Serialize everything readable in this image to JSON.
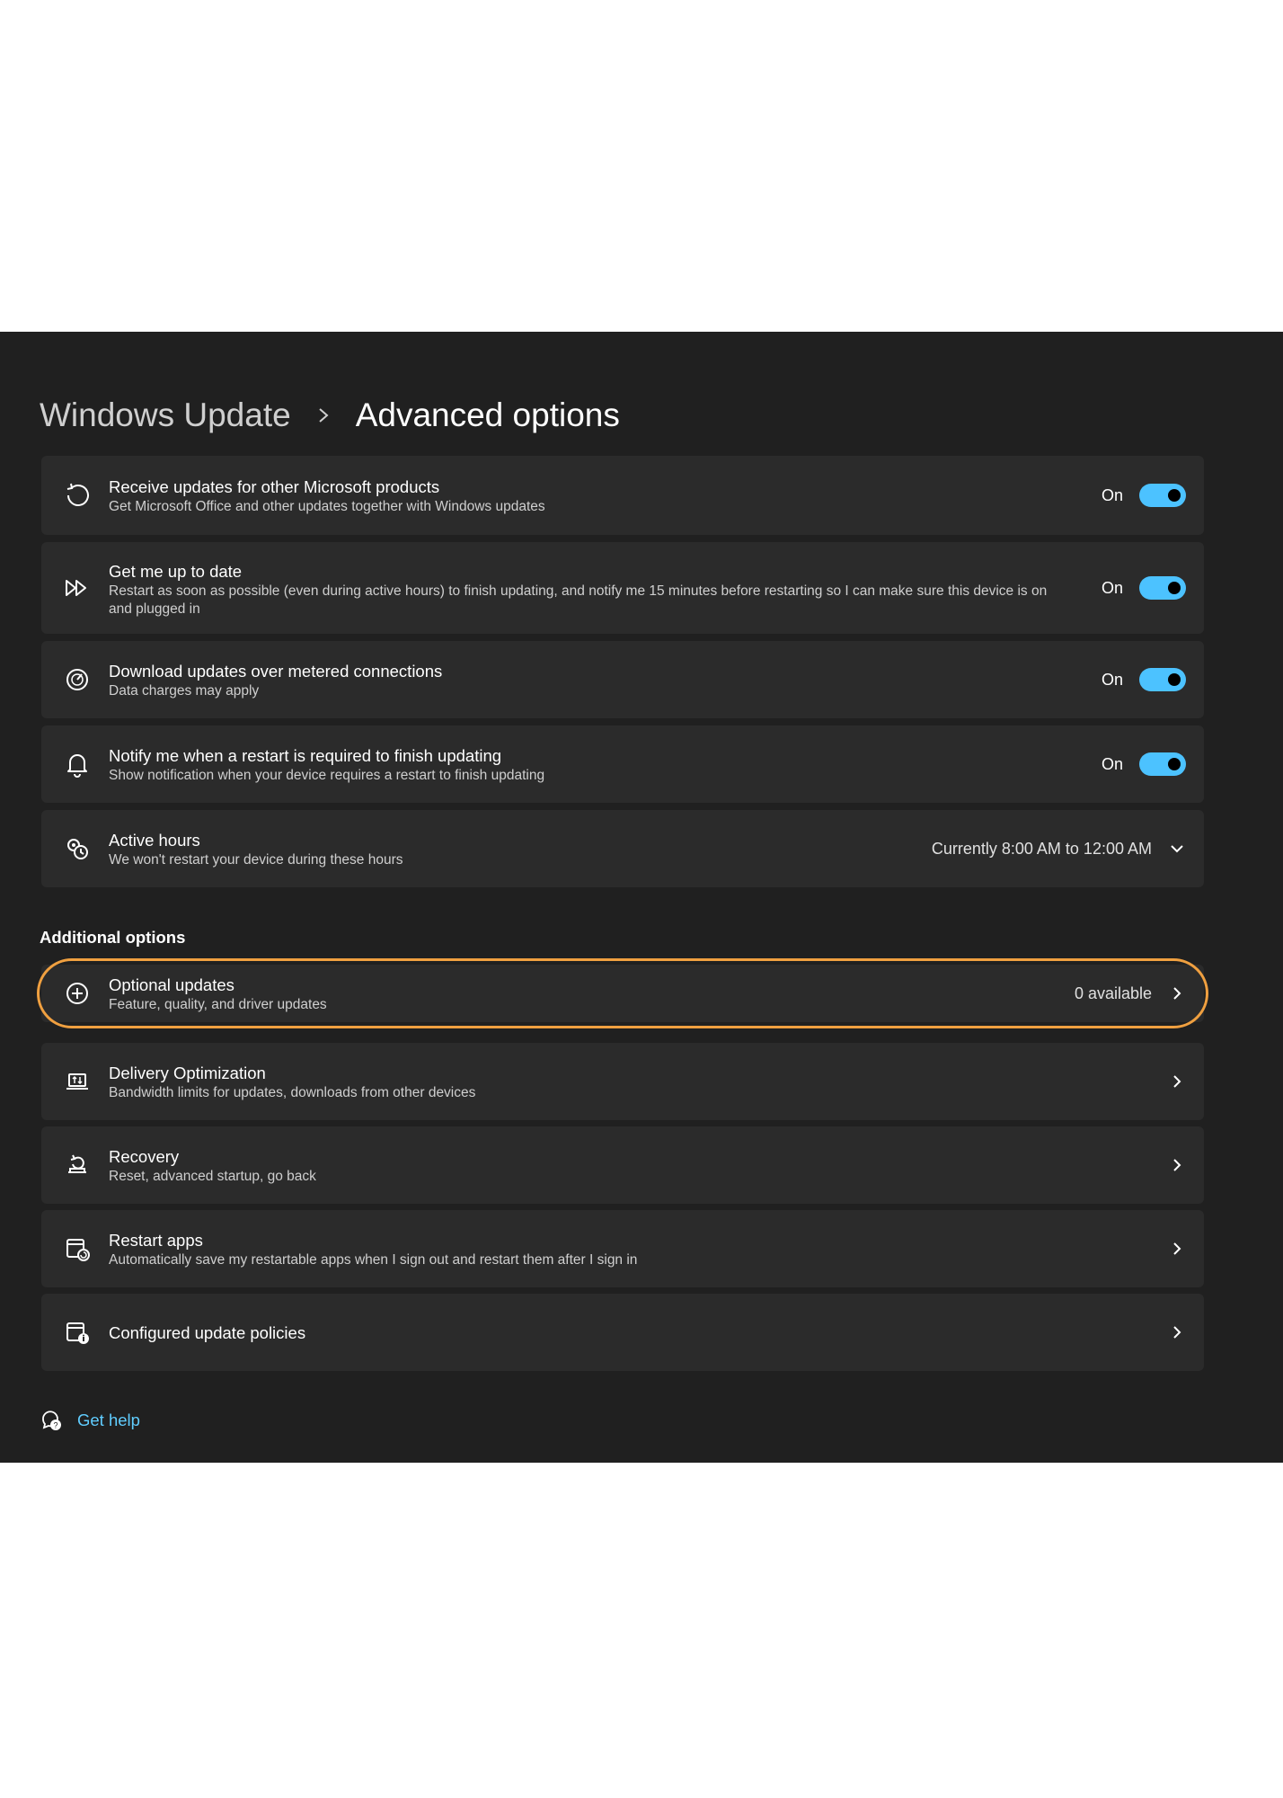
{
  "breadcrumb": {
    "parent": "Windows Update",
    "current": "Advanced options"
  },
  "settings": [
    {
      "title": "Receive updates for other Microsoft products",
      "desc": "Get Microsoft Office and other updates together with Windows updates",
      "state": "On",
      "icon": "refresh-icon"
    },
    {
      "title": "Get me up to date",
      "desc": "Restart as soon as possible (even during active hours) to finish updating, and notify me 15 minutes before restarting so I can make sure this device is on and plugged in",
      "state": "On",
      "icon": "fast-forward-icon"
    },
    {
      "title": "Download updates over metered connections",
      "desc": "Data charges may apply",
      "state": "On",
      "icon": "gauge-icon"
    },
    {
      "title": "Notify me when a restart is required to finish updating",
      "desc": "Show notification when your device requires a restart to finish updating",
      "state": "On",
      "icon": "bell-icon"
    },
    {
      "title": "Active hours",
      "desc": "We won't restart your device during these hours",
      "value": "Currently 8:00 AM to 12:00 AM",
      "icon": "clock-gear-icon"
    }
  ],
  "additional": {
    "heading": "Additional options",
    "items": [
      {
        "title": "Optional updates",
        "desc": "Feature, quality, and driver updates",
        "value": "0 available",
        "icon": "circle-plus-icon"
      },
      {
        "title": "Delivery Optimization",
        "desc": "Bandwidth limits for updates, downloads from other devices",
        "icon": "delivery-optimization-icon"
      },
      {
        "title": "Recovery",
        "desc": "Reset, advanced startup, go back",
        "icon": "recovery-icon"
      },
      {
        "title": "Restart apps",
        "desc": "Automatically save my restartable apps when I sign out and restart them after I sign in",
        "icon": "restart-apps-icon"
      },
      {
        "title": "Configured update policies",
        "icon": "policy-icon"
      }
    ]
  },
  "help": {
    "label": "Get help",
    "icon": "help-chat-icon"
  },
  "colors": {
    "accent": "#4cc2ff",
    "link": "#60cdff",
    "highlight": "#f0a040",
    "panel": "#202020",
    "card": "#2b2b2b"
  }
}
